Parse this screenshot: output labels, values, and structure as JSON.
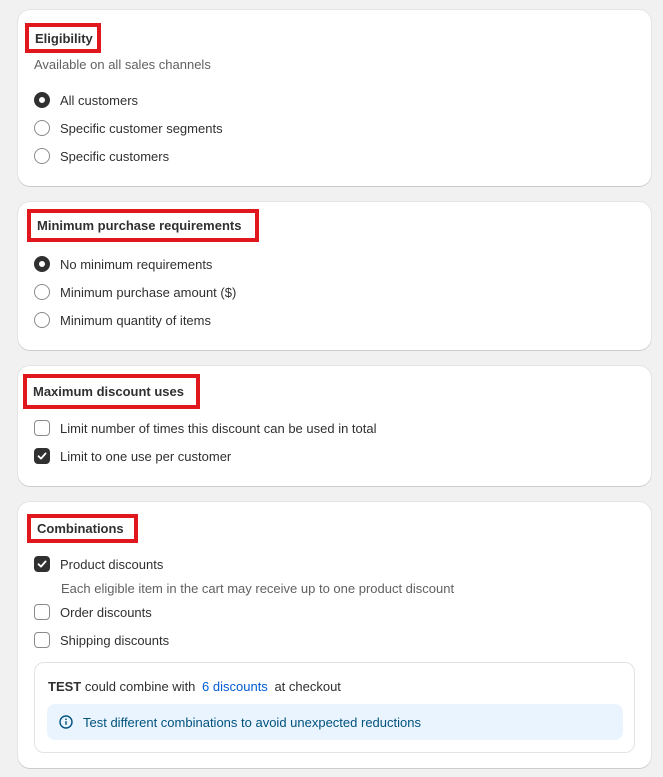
{
  "eligibility": {
    "title": "Eligibility",
    "subtitle": "Available on all sales channels",
    "options": [
      {
        "label": "All customers",
        "selected": true
      },
      {
        "label": "Specific customer segments",
        "selected": false
      },
      {
        "label": "Specific customers",
        "selected": false
      }
    ]
  },
  "minimum_purchase": {
    "title": "Minimum purchase requirements",
    "options": [
      {
        "label": "No minimum requirements",
        "selected": true
      },
      {
        "label": "Minimum purchase amount ($)",
        "selected": false
      },
      {
        "label": "Minimum quantity of items",
        "selected": false
      }
    ]
  },
  "maximum_uses": {
    "title": "Maximum discount uses",
    "options": [
      {
        "label": "Limit number of times this discount can be used in total",
        "checked": false
      },
      {
        "label": "Limit to one use per customer",
        "checked": true
      }
    ]
  },
  "combinations": {
    "title": "Combinations",
    "options": [
      {
        "label": "Product discounts",
        "checked": true,
        "help": "Each eligible item in the cart may receive up to one product discount"
      },
      {
        "label": "Order discounts",
        "checked": false
      },
      {
        "label": "Shipping discounts",
        "checked": false
      }
    ],
    "summary": {
      "code": "TEST",
      "text_before": "could combine with",
      "link": "6 discounts",
      "text_after": "at checkout"
    },
    "banner_text": "Test different combinations to avoid unexpected reductions",
    "banner_icon": "info-icon"
  },
  "colors": {
    "highlight": "#e0171c",
    "link": "#005bd3",
    "banner_bg": "#eaf4ff"
  }
}
